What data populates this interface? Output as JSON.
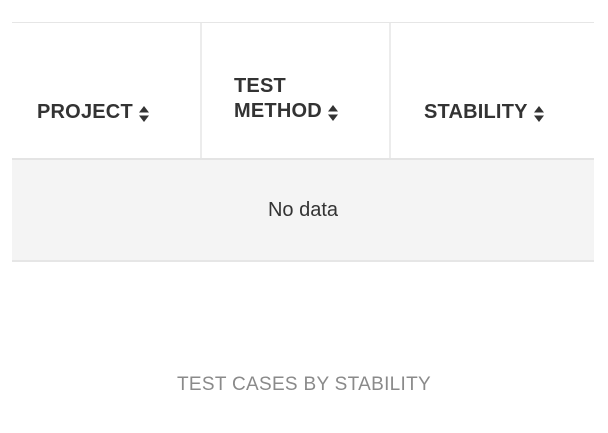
{
  "table": {
    "columns": [
      {
        "label": "PROJECT",
        "sort_icon": "sort-icon"
      },
      {
        "label": "TEST\nMETHOD",
        "sort_icon": "sort-icon"
      },
      {
        "label": "STABILITY",
        "sort_icon": "sort-icon"
      }
    ],
    "empty_text": "No data"
  },
  "section": {
    "title": "TEST CASES BY STABILITY"
  }
}
